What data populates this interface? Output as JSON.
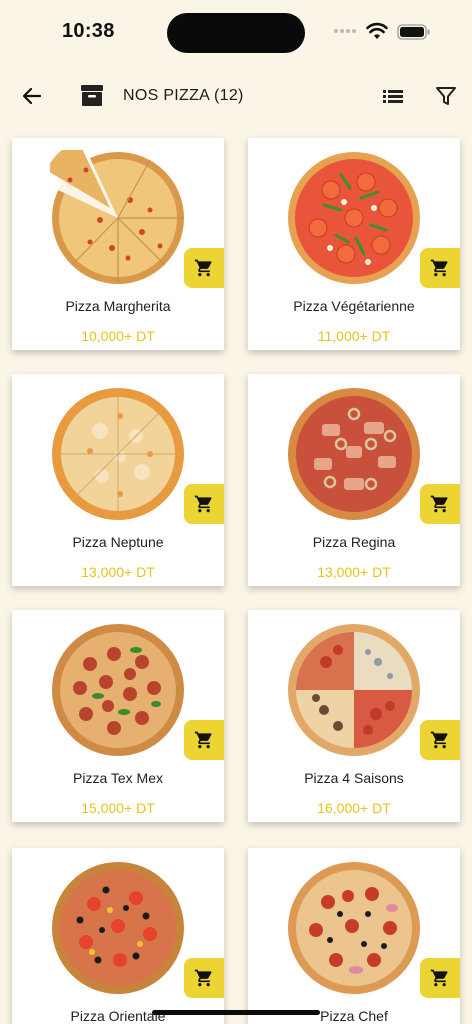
{
  "status": {
    "time": "10:38"
  },
  "header": {
    "title": "NOS PIZZA (12)"
  },
  "colors": {
    "background": "#fbf5e7",
    "accent": "#ecd432",
    "price": "#e6c31c"
  },
  "products": [
    {
      "name": "Pizza Margherita",
      "price": "10,000+ DT"
    },
    {
      "name": "Pizza Végétarienne",
      "price": "11,000+ DT"
    },
    {
      "name": "Pizza Neptune",
      "price": "13,000+ DT"
    },
    {
      "name": "Pizza Regina",
      "price": "13,000+ DT"
    },
    {
      "name": "Pizza Tex Mex",
      "price": "15,000+ DT"
    },
    {
      "name": "Pizza 4 Saisons",
      "price": "16,000+ DT"
    },
    {
      "name": "Pizza Orientale",
      "price": ""
    },
    {
      "name": "Pizza Chef",
      "price": ""
    }
  ],
  "icons": {
    "back": "arrow-left-icon",
    "category": "box-icon",
    "list": "list-view-icon",
    "filter": "filter-icon",
    "cart": "cart-icon"
  }
}
